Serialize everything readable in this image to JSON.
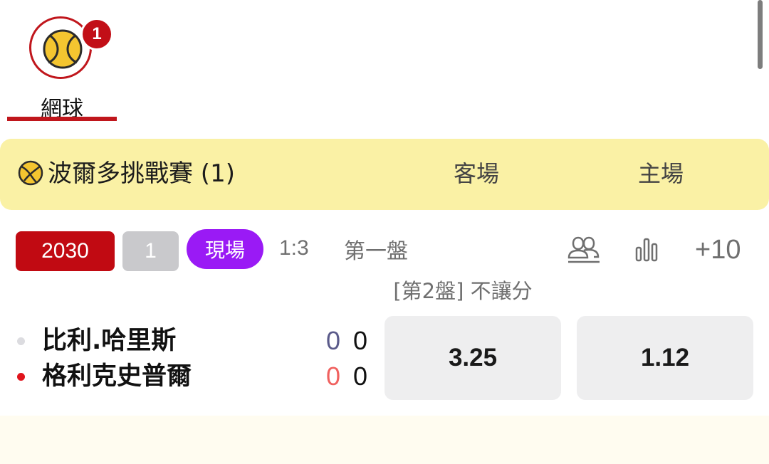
{
  "sport_tab": {
    "label": "網球",
    "badge_count": "1",
    "icon": "tennis-ball-icon",
    "accent_color": "#c0161c"
  },
  "league": {
    "name": "波爾多挑戰賽 (1)",
    "icon": "tennis-ball-icon",
    "col_away": "客場",
    "col_home": "主場",
    "background": "#faf1a5"
  },
  "match": {
    "time": "2030",
    "count": "1",
    "live_label": "現場",
    "live_color": "#9a1af5",
    "score": "1:3",
    "set": "第一盤",
    "more_bets": "+10",
    "market": "[第2盤] 不讓分",
    "teams": [
      {
        "name": "比利.哈里斯",
        "set_score": "0",
        "game_score": "0"
      },
      {
        "name": "格利克史普爾",
        "set_score": "0",
        "game_score": "0"
      }
    ],
    "odds": {
      "away": "3.25",
      "home": "1.12"
    }
  }
}
